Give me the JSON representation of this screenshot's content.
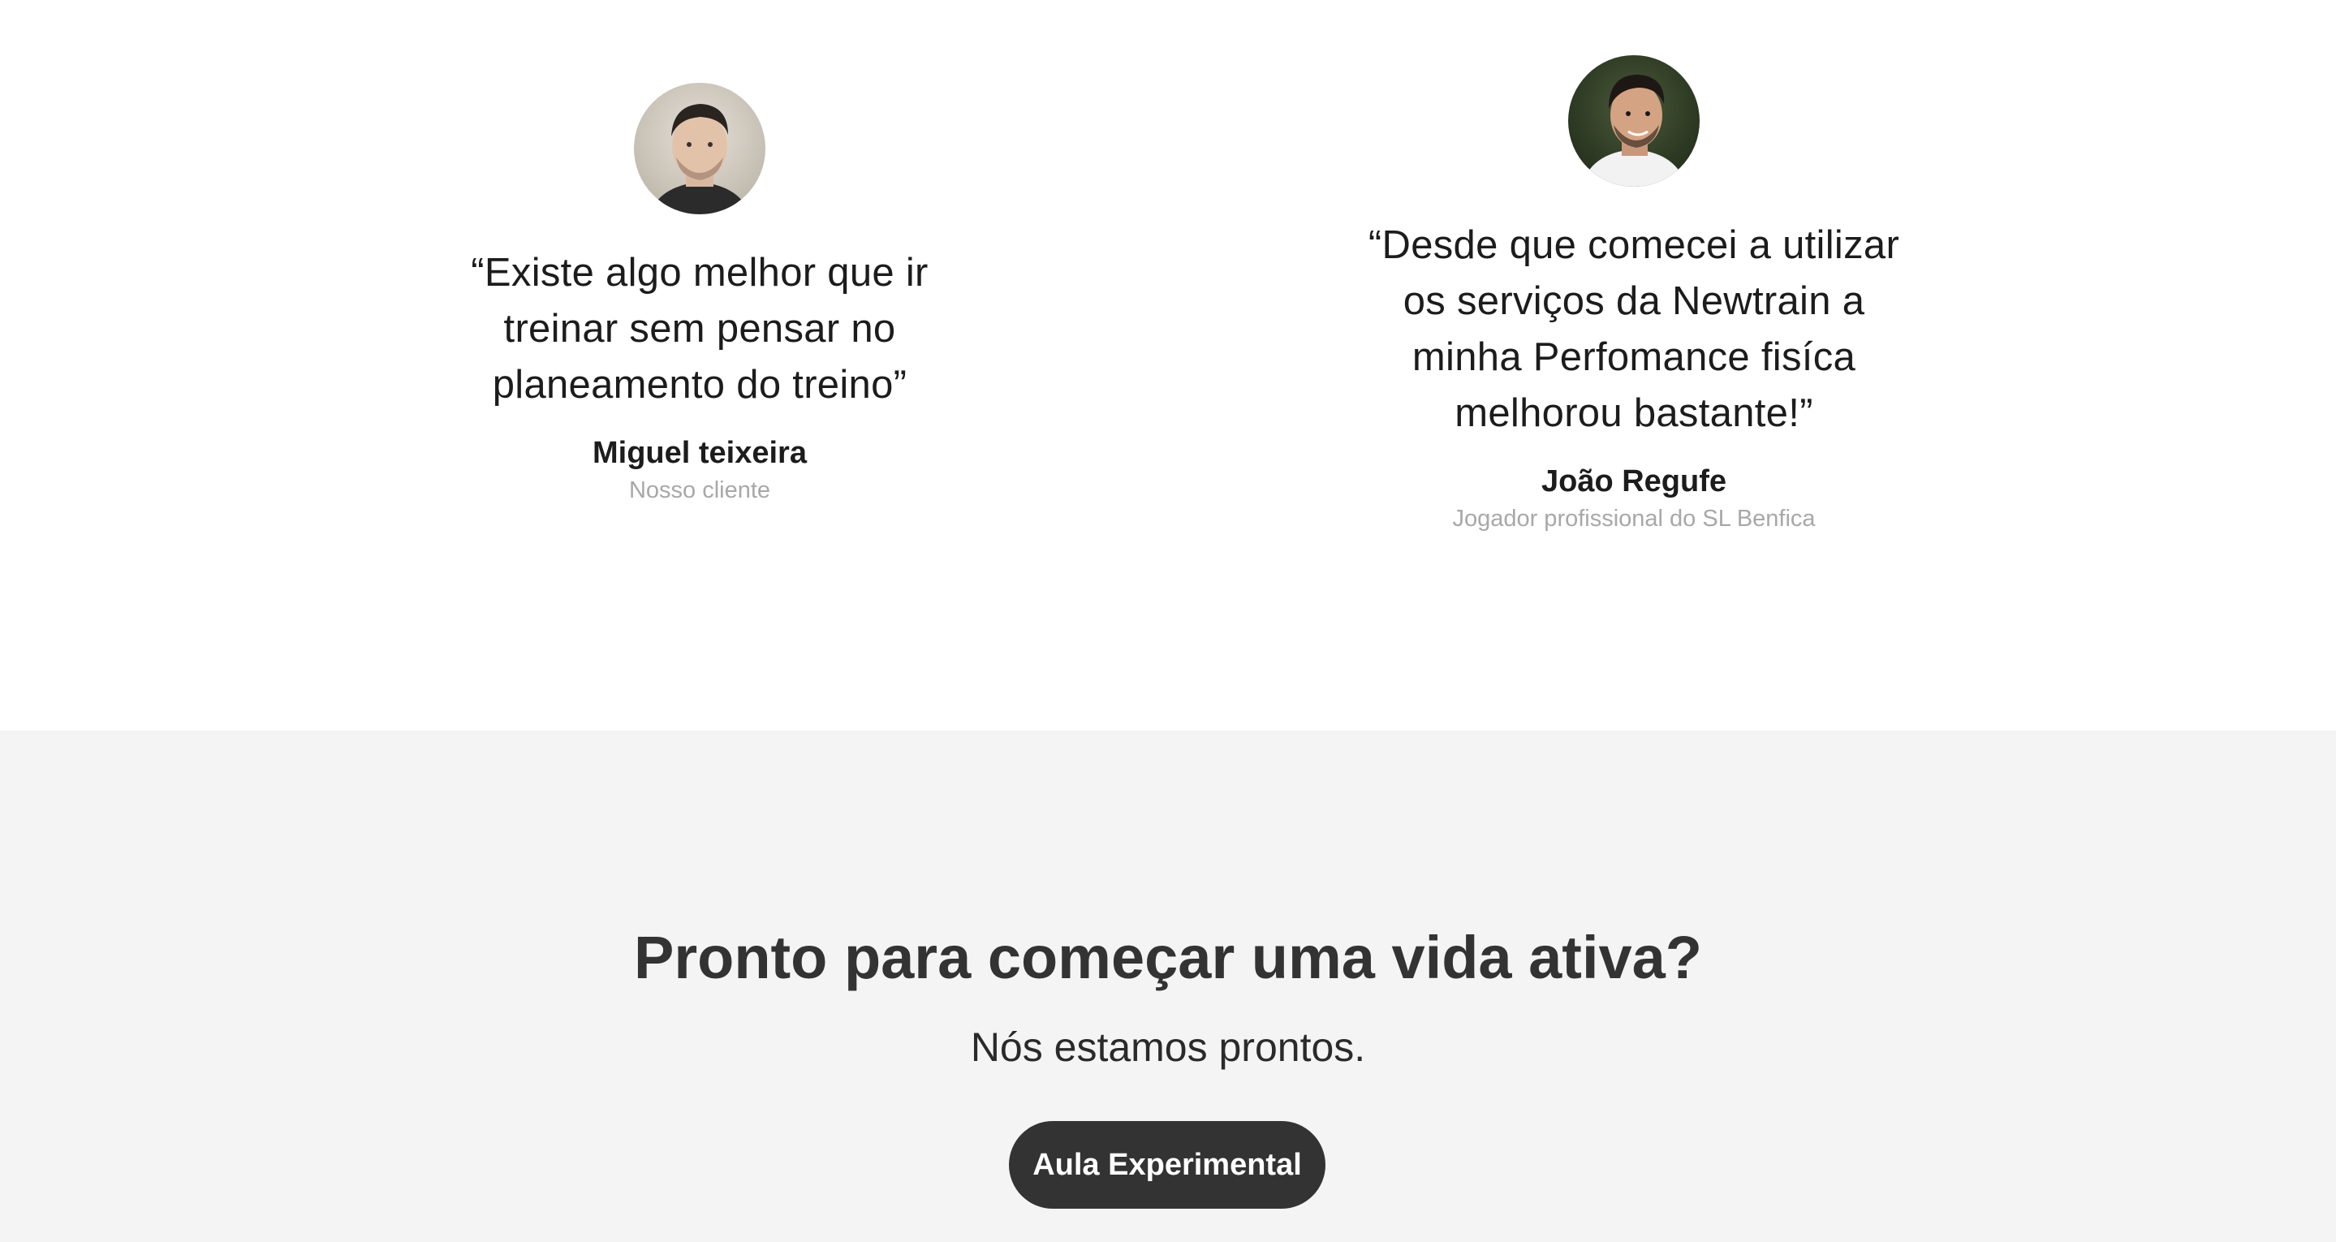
{
  "testimonials": [
    {
      "quote": "“Existe algo melhor que ir treinar sem pensar no planeamento do treino”",
      "name": "Miguel teixeira",
      "role": "Nosso cliente"
    },
    {
      "quote": "“Desde que comecei a utilizar os serviços da Newtrain a minha Perfomance fisíca melhorou bastante!”",
      "name": "João Regufe",
      "role": "Jogador profissional do SL Benfica"
    }
  ],
  "cta": {
    "title": "Pronto para começar uma vida ativa?",
    "subtitle": "Nós estamos prontos.",
    "button_label": "Aula Experimental"
  },
  "colors": {
    "cta_background": "#f4f4f4",
    "button_background": "#333333",
    "text_dark": "#1c1c1c",
    "text_muted": "#a8a8a8"
  }
}
